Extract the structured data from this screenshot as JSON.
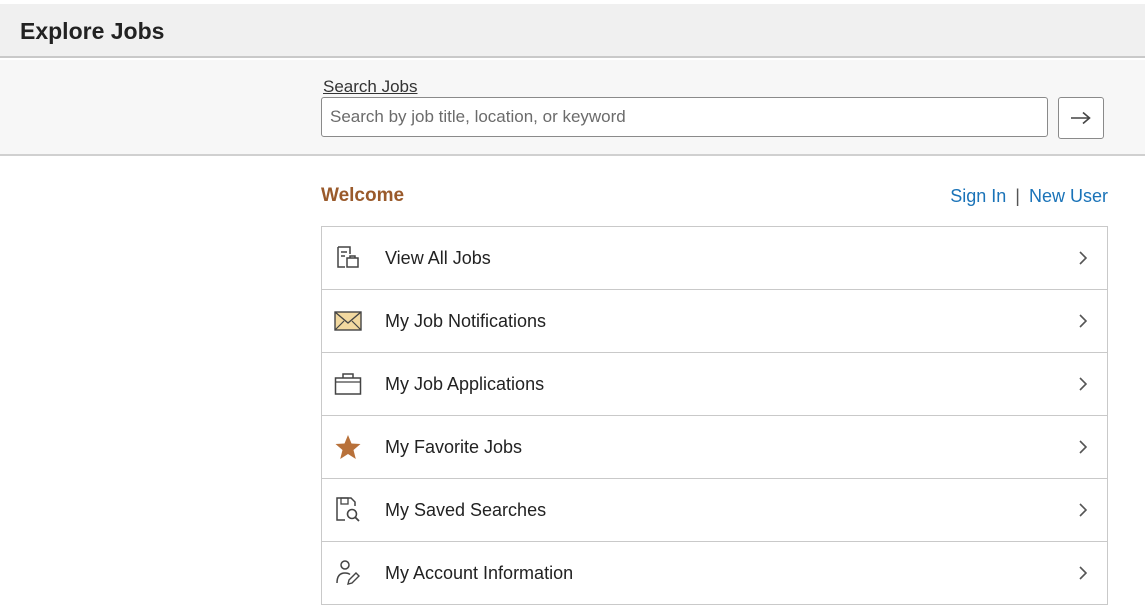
{
  "header": {
    "title": "Explore Jobs"
  },
  "search": {
    "label": "Search Jobs",
    "placeholder": "Search by job title, location, or keyword",
    "value": "",
    "submit_icon": "arrow-right-icon"
  },
  "welcome": {
    "heading": "Welcome",
    "sign_in": "Sign In",
    "separator": "|",
    "new_user": "New User"
  },
  "menu": {
    "items": [
      {
        "label": "View All Jobs",
        "icon": "job-list-icon"
      },
      {
        "label": "My Job Notifications",
        "icon": "envelope-icon"
      },
      {
        "label": "My Job Applications",
        "icon": "briefcase-icon"
      },
      {
        "label": "My Favorite Jobs",
        "icon": "star-icon"
      },
      {
        "label": "My Saved Searches",
        "icon": "saved-search-icon"
      },
      {
        "label": "My Account Information",
        "icon": "user-edit-icon"
      }
    ]
  },
  "colors": {
    "accent_heading": "#9a5a2b",
    "link": "#1a73b8",
    "star": "#b8713a",
    "envelope_fill": "#f2d9a0"
  }
}
